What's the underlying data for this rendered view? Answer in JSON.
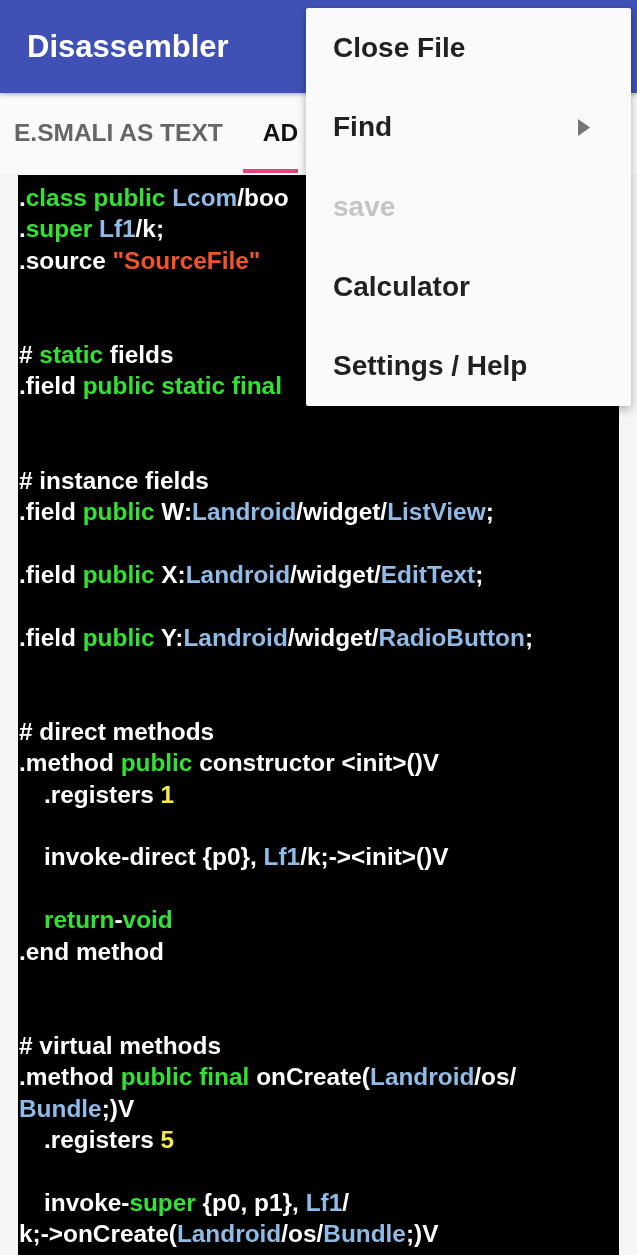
{
  "app_bar": {
    "title": "Disassembler"
  },
  "tabs": [
    {
      "label": "E.SMALI AS TEXT",
      "selected": false
    },
    {
      "label": "AD",
      "selected": true
    }
  ],
  "menu": {
    "items": [
      {
        "label": "Close File",
        "disabled": false,
        "has_submenu": false
      },
      {
        "label": "Find",
        "disabled": false,
        "has_submenu": true
      },
      {
        "label": "save",
        "disabled": true,
        "has_submenu": false
      },
      {
        "label": "Calculator",
        "disabled": false,
        "has_submenu": false
      },
      {
        "label": "Settings / Help",
        "disabled": false,
        "has_submenu": false
      }
    ]
  },
  "code": {
    "lines": [
      {
        "kind": "code",
        "tokens": [
          {
            "text": ".",
            "kind": "plain"
          },
          {
            "text": "class public ",
            "kind": "keyword"
          },
          {
            "text": "Lcom",
            "kind": "type"
          },
          {
            "text": "/boo",
            "kind": "plain"
          }
        ]
      },
      {
        "kind": "code",
        "tokens": [
          {
            "text": ".",
            "kind": "plain"
          },
          {
            "text": "super ",
            "kind": "keyword"
          },
          {
            "text": "Lf1",
            "kind": "type"
          },
          {
            "text": "/k;",
            "kind": "plain"
          }
        ]
      },
      {
        "kind": "code",
        "tokens": [
          {
            "text": ".source ",
            "kind": "plain"
          },
          {
            "text": "\"SourceFile\"",
            "kind": "string"
          }
        ]
      },
      {
        "kind": "blank"
      },
      {
        "kind": "blank"
      },
      {
        "kind": "code",
        "tokens": [
          {
            "text": "# ",
            "kind": "plain"
          },
          {
            "text": "static",
            "kind": "keyword"
          },
          {
            "text": " fields",
            "kind": "plain"
          }
        ]
      },
      {
        "kind": "code",
        "tokens": [
          {
            "text": ".field ",
            "kind": "plain"
          },
          {
            "text": "public static final",
            "kind": "keyword"
          }
        ]
      },
      {
        "kind": "blank"
      },
      {
        "kind": "blank"
      },
      {
        "kind": "code",
        "tokens": [
          {
            "text": "# instance fields",
            "kind": "plain"
          }
        ]
      },
      {
        "kind": "code",
        "tokens": [
          {
            "text": ".field ",
            "kind": "plain"
          },
          {
            "text": "public",
            "kind": "keyword"
          },
          {
            "text": " W:",
            "kind": "plain"
          },
          {
            "text": "Landroid",
            "kind": "type"
          },
          {
            "text": "/widget/",
            "kind": "plain"
          },
          {
            "text": "ListView",
            "kind": "type"
          },
          {
            "text": ";",
            "kind": "plain"
          }
        ]
      },
      {
        "kind": "blank"
      },
      {
        "kind": "code",
        "tokens": [
          {
            "text": ".field ",
            "kind": "plain"
          },
          {
            "text": "public",
            "kind": "keyword"
          },
          {
            "text": " X:",
            "kind": "plain"
          },
          {
            "text": "Landroid",
            "kind": "type"
          },
          {
            "text": "/widget/",
            "kind": "plain"
          },
          {
            "text": "EditText",
            "kind": "type"
          },
          {
            "text": ";",
            "kind": "plain"
          }
        ]
      },
      {
        "kind": "blank"
      },
      {
        "kind": "code",
        "tokens": [
          {
            "text": ".field ",
            "kind": "plain"
          },
          {
            "text": "public",
            "kind": "keyword"
          },
          {
            "text": " Y:",
            "kind": "plain"
          },
          {
            "text": "Landroid",
            "kind": "type"
          },
          {
            "text": "/widget/",
            "kind": "plain"
          },
          {
            "text": "RadioButton",
            "kind": "type"
          },
          {
            "text": ";",
            "kind": "plain"
          }
        ]
      },
      {
        "kind": "blank"
      },
      {
        "kind": "blank"
      },
      {
        "kind": "code",
        "tokens": [
          {
            "text": "# direct methods",
            "kind": "plain"
          }
        ]
      },
      {
        "kind": "code",
        "tokens": [
          {
            "text": ".method ",
            "kind": "plain"
          },
          {
            "text": "public",
            "kind": "keyword"
          },
          {
            "text": " constructor <init>()V",
            "kind": "plain"
          }
        ],
        "children": [
          {
            "kind": "code",
            "tokens": [
              {
                "text": ".registers ",
                "kind": "plain"
              },
              {
                "text": "1",
                "kind": "number"
              }
            ]
          },
          {
            "kind": "blank"
          },
          {
            "kind": "code",
            "tokens": [
              {
                "text": "invoke-direct {p0}, ",
                "kind": "plain"
              },
              {
                "text": "Lf1",
                "kind": "type"
              },
              {
                "text": "/k;-><init>()V",
                "kind": "plain"
              }
            ]
          },
          {
            "kind": "blank"
          },
          {
            "kind": "code",
            "tokens": [
              {
                "text": "return",
                "kind": "keyword"
              },
              {
                "text": "-",
                "kind": "plain"
              },
              {
                "text": "void",
                "kind": "keyword"
              }
            ]
          }
        ]
      },
      {
        "kind": "code",
        "tokens": [
          {
            "text": ".end method",
            "kind": "plain"
          }
        ]
      },
      {
        "kind": "blank"
      },
      {
        "kind": "blank"
      },
      {
        "kind": "code",
        "tokens": [
          {
            "text": "# virtual methods",
            "kind": "plain"
          }
        ]
      },
      {
        "kind": "code",
        "tokens": [
          {
            "text": ".method ",
            "kind": "plain"
          },
          {
            "text": "public final",
            "kind": "keyword"
          },
          {
            "text": " onCreate(",
            "kind": "plain"
          },
          {
            "text": "Landroid",
            "kind": "type"
          },
          {
            "text": "/os/",
            "kind": "plain"
          }
        ]
      },
      {
        "kind": "code",
        "tokens": [
          {
            "text": "Bundle",
            "kind": "type"
          },
          {
            "text": ";)V",
            "kind": "plain"
          }
        ],
        "children": [
          {
            "kind": "code",
            "tokens": [
              {
                "text": ".registers ",
                "kind": "plain"
              },
              {
                "text": "5",
                "kind": "number"
              }
            ]
          },
          {
            "kind": "blank"
          },
          {
            "kind": "code",
            "tokens": [
              {
                "text": "invoke-",
                "kind": "plain"
              },
              {
                "text": "super",
                "kind": "keyword"
              },
              {
                "text": " {p0, p1}, ",
                "kind": "plain"
              },
              {
                "text": "Lf1",
                "kind": "type"
              },
              {
                "text": "/",
                "kind": "plain"
              }
            ]
          }
        ]
      },
      {
        "kind": "code",
        "tokens": [
          {
            "text": "k;->onCreate(",
            "kind": "plain"
          },
          {
            "text": "Landroid",
            "kind": "type"
          },
          {
            "text": "/os/",
            "kind": "plain"
          },
          {
            "text": "Bundle",
            "kind": "type"
          },
          {
            "text": ";)V",
            "kind": "plain"
          }
        ]
      }
    ]
  }
}
